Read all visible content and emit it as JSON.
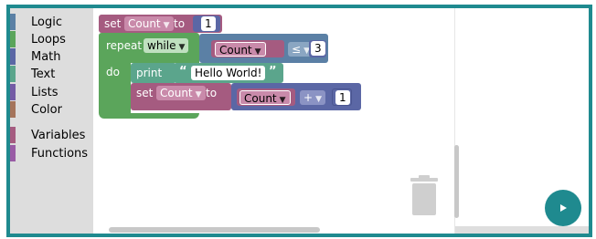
{
  "toolbox": {
    "categories": [
      {
        "label": "Logic",
        "color": "#5b80a5"
      },
      {
        "label": "Loops",
        "color": "#5ba55b"
      },
      {
        "label": "Math",
        "color": "#5b67a5"
      },
      {
        "label": "Text",
        "color": "#5ba58c"
      },
      {
        "label": "Lists",
        "color": "#745ba5"
      },
      {
        "label": "Color",
        "color": "#a5745b"
      },
      {
        "label": "Variables",
        "color": "#a55b80"
      },
      {
        "label": "Functions",
        "color": "#995ba5"
      }
    ]
  },
  "blocks": {
    "set1": {
      "set": "set",
      "var": "Count",
      "to": "to",
      "value": "1"
    },
    "repeat": {
      "repeat": "repeat",
      "mode": "while",
      "do": "do",
      "var": "Count",
      "op": "≤",
      "value": "3"
    },
    "print": {
      "print": "print",
      "open_quote": "“",
      "text": "Hello World!",
      "close_quote": "”"
    },
    "set2": {
      "set": "set",
      "var": "Count",
      "to": "to",
      "var2": "Count",
      "op": "+",
      "value": "1"
    }
  },
  "colors": {
    "variables": "#a55b80",
    "loops": "#5ba55b",
    "math": "#5b67a5",
    "text": "#5ba58c",
    "accent": "#1f8a8f"
  },
  "icons": {
    "trash": "trash-icon",
    "run": "play-icon"
  }
}
